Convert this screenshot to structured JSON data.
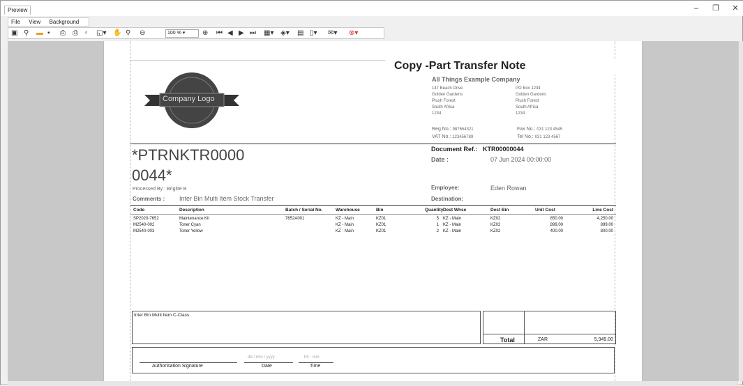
{
  "window": {
    "title": "Preview",
    "min": "–",
    "max": "❐",
    "close": "✕"
  },
  "menu": [
    "File",
    "View",
    "Background"
  ],
  "toolbar": {
    "zoom": "100 %"
  },
  "doc": {
    "logo_text": "Company Logo",
    "title": "Copy -Part Transfer Note",
    "company": "All Things Example Company",
    "addr1": [
      "147 Beach Drive",
      "Golden Gardens",
      "Plush Forest",
      "South Africa",
      "1234"
    ],
    "addr2": [
      "PO Box 1234",
      "Golden Gardens",
      "Plush Forest",
      "South Africa",
      "1234"
    ],
    "reg_label": "Reg No.:",
    "reg": "987654321",
    "vat_label": "VAT No.:",
    "vat": "123456789",
    "fax_label": "Fax No.:",
    "fax": "031 123 4545",
    "tel_label": "Tel No.:",
    "tel": "031 123 4567",
    "barcode1": "*PTRNKTR0000",
    "barcode2": "0044*",
    "docref_label": "Document Ref.:",
    "docref": "KTR00000044",
    "date_label": "Date :",
    "date": "07 Jun 2024 00:00:00",
    "processed": "Processed By : Brigitte B",
    "comments_label": "Comments :",
    "comments": "Inter Bin Multi Item Stock Transfer",
    "employee_label": "Employee:",
    "employee": "Eden Rowan",
    "dest_label": "Destination:",
    "columns": [
      "Code",
      "Description",
      "Batch / Serial No.",
      "Warehouse",
      "Bin",
      "Quantity",
      "Dest Whse",
      "Dest Bin",
      "Unit Cost",
      "Line Cost"
    ],
    "rows": [
      [
        "SP2020-7652",
        "Maintenance Kit",
        "7652A001",
        "KZ - Main",
        "KZ01",
        "5",
        "KZ - Main",
        "KZ02",
        "850.00",
        "4,250.00"
      ],
      [
        "M2540-002",
        "Toner Cyan",
        "",
        "KZ - Main",
        "KZ01",
        "1",
        "KZ - Main",
        "KZ02",
        "899.00",
        "899.00"
      ],
      [
        "M2540-003",
        "Toner Yellow",
        "",
        "KZ - Main",
        "KZ01",
        "2",
        "KZ - Main",
        "KZ02",
        "400.00",
        "800.00"
      ]
    ],
    "note": "Inter Bin Multi Item C-Class",
    "total_label": "Total",
    "currency": "ZAR",
    "total": "5,949.00",
    "date_ph": "dd / mm / yyyy",
    "time_ph": "hh : mm",
    "auth_label": "Authorisation Signature",
    "date_cap": "Date",
    "time_cap": "Time"
  }
}
